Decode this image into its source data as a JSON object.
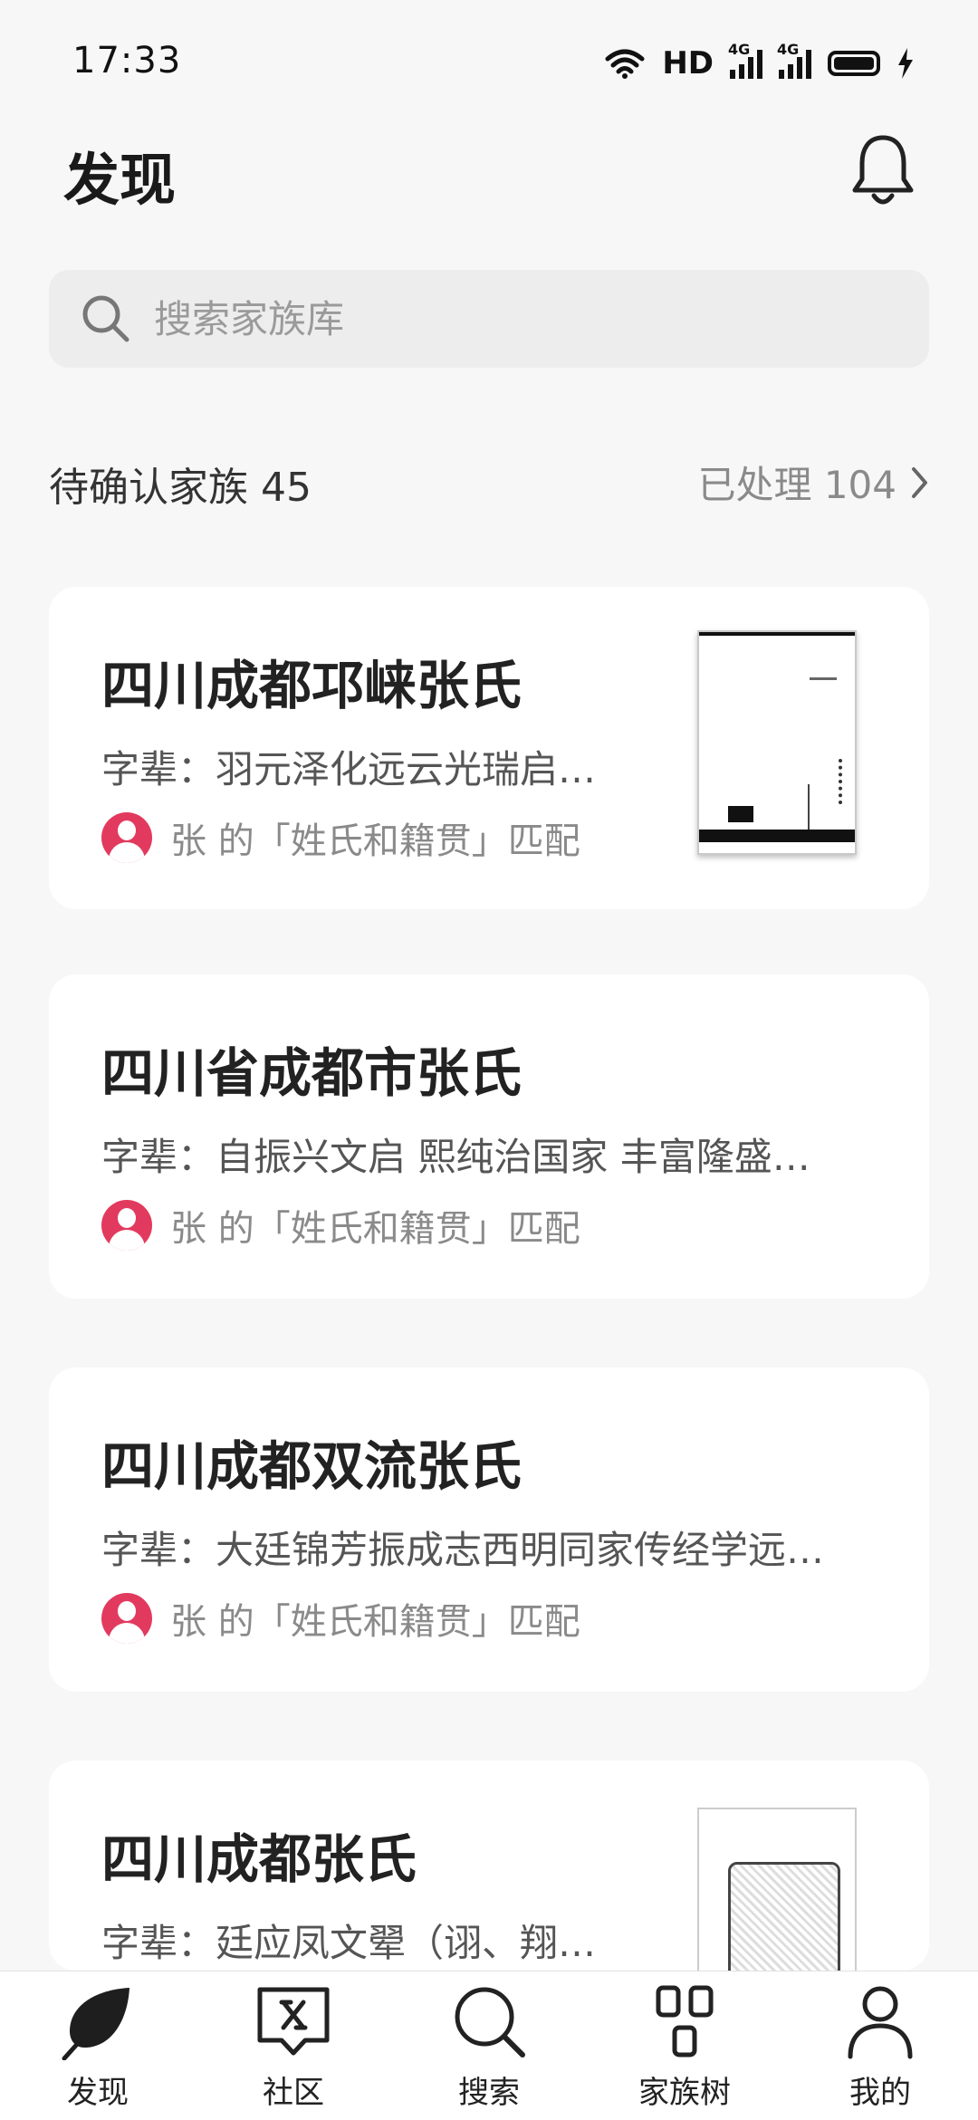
{
  "status_bar": {
    "time": "17:33",
    "network_hd": "HD",
    "sig1_type": "4G",
    "sig2_type": "4G"
  },
  "header": {
    "title": "发现"
  },
  "search": {
    "placeholder": "搜索家族库"
  },
  "pending": {
    "label": "待确认家族 45",
    "processed_label": "已处理 104"
  },
  "cards": [
    {
      "title": "四川成都邛崃张氏",
      "generation": "字辈：羽元泽化远云光瑞启…",
      "match": "张 的「姓氏和籍贯」匹配",
      "has_thumbnail": true
    },
    {
      "title": "四川省成都市张氏",
      "generation": "字辈：自振兴文启 熙纯治国家 丰富隆盛…",
      "match": "张 的「姓氏和籍贯」匹配",
      "has_thumbnail": false
    },
    {
      "title": "四川成都双流张氏",
      "generation": "字辈：大廷锦芳振成志西明同家传经学远…",
      "match": "张 的「姓氏和籍贯」匹配",
      "has_thumbnail": false
    },
    {
      "title": "四川成都张氏",
      "generation": "字辈：廷应凤文翚（诩、翔…",
      "match": "",
      "has_thumbnail": true
    }
  ],
  "bottom_nav": [
    {
      "label": "发现",
      "icon": "leaf-icon",
      "active": true
    },
    {
      "label": "社区",
      "icon": "chat-icon",
      "active": false
    },
    {
      "label": "搜索",
      "icon": "search-icon",
      "active": false
    },
    {
      "label": "家族树",
      "icon": "tree-icon",
      "active": false
    },
    {
      "label": "我的",
      "icon": "person-icon",
      "active": false
    }
  ]
}
